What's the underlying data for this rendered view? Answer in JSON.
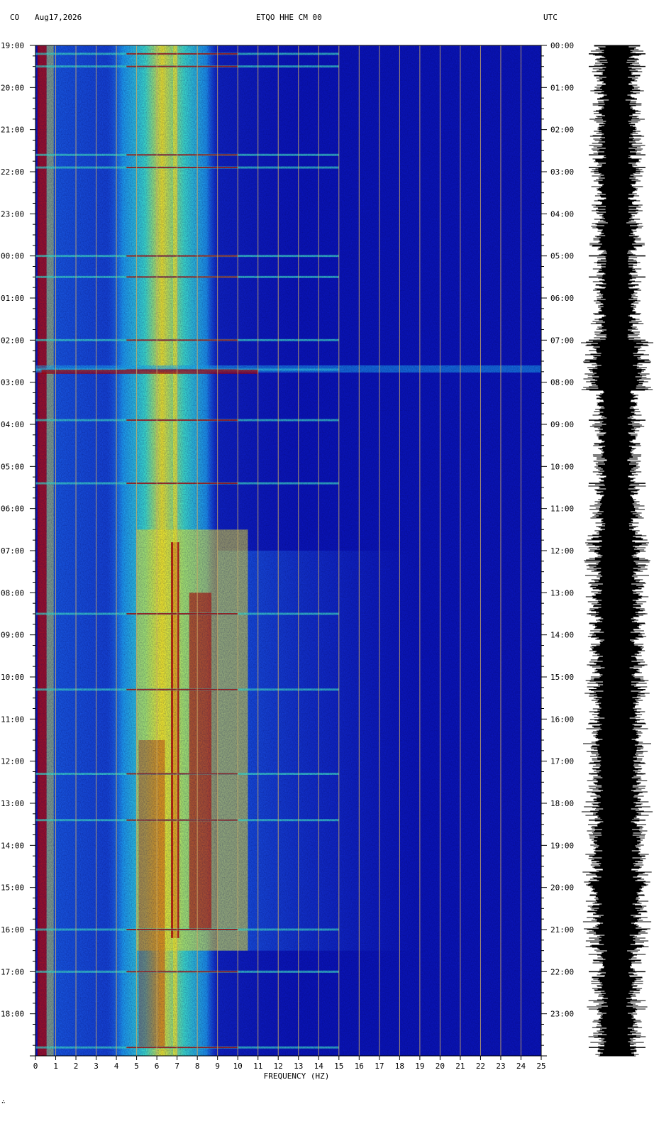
{
  "header": {
    "network": "CO",
    "date": "Aug17,2026",
    "station": "ETQO HHE CM 00",
    "timezone": "UTC"
  },
  "footer_mark": "∴",
  "chart_data": {
    "type": "heatmap",
    "title": "ETQO HHE CM 00",
    "xlabel": "FREQUENCY (HZ)",
    "ylabel": "",
    "xlim": [
      0,
      25
    ],
    "x_ticks": [
      "0",
      "1",
      "2",
      "3",
      "4",
      "5",
      "6",
      "7",
      "8",
      "9",
      "10",
      "11",
      "12",
      "13",
      "14",
      "15",
      "16",
      "17",
      "18",
      "19",
      "20",
      "21",
      "22",
      "23",
      "24",
      "25"
    ],
    "y_left_ticks": [
      "19:00",
      "20:00",
      "21:00",
      "22:00",
      "23:00",
      "00:00",
      "01:00",
      "02:00",
      "03:00",
      "04:00",
      "05:00",
      "06:00",
      "07:00",
      "08:00",
      "09:00",
      "10:00",
      "11:00",
      "12:00",
      "13:00",
      "14:00",
      "15:00",
      "16:00",
      "17:00",
      "18:00"
    ],
    "y_right_ticks": [
      "00:00",
      "01:00",
      "02:00",
      "03:00",
      "04:00",
      "05:00",
      "06:00",
      "07:00",
      "08:00",
      "09:00",
      "10:00",
      "11:00",
      "12:00",
      "13:00",
      "14:00",
      "15:00",
      "16:00",
      "17:00",
      "18:00",
      "19:00",
      "20:00",
      "21:00",
      "22:00",
      "23:00"
    ],
    "hours_span": 24,
    "grid": true,
    "colors": {
      "background": "#0a14b4",
      "low": "#1e3cd2",
      "mid": "#1eaaf0",
      "cyan": "#3cdcc8",
      "yellow": "#f0e628",
      "red": "#b40000",
      "grid": "#c8aa64"
    },
    "energy_bands": [
      {
        "name": "low-edge",
        "fmin": 0.1,
        "fmax": 0.6,
        "level": "red"
      },
      {
        "name": "microseism",
        "fmin": 3.5,
        "fmax": 9.0,
        "level": "cyan"
      },
      {
        "name": "peak",
        "fmin": 5.0,
        "fmax": 7.0,
        "level": "yellow"
      },
      {
        "name": "line-6.9hz",
        "fmin": 6.8,
        "fmax": 7.0,
        "level": "red"
      },
      {
        "name": "daytime-8hz",
        "fmin": 7.5,
        "fmax": 8.7,
        "level": "red"
      }
    ],
    "events_hours": [
      0.2,
      0.5,
      2.6,
      2.9,
      5.0,
      5.5,
      7.0,
      7.7,
      8.9,
      10.4,
      13.5,
      15.3,
      17.3,
      18.4,
      21.0,
      22.0,
      23.8
    ]
  }
}
